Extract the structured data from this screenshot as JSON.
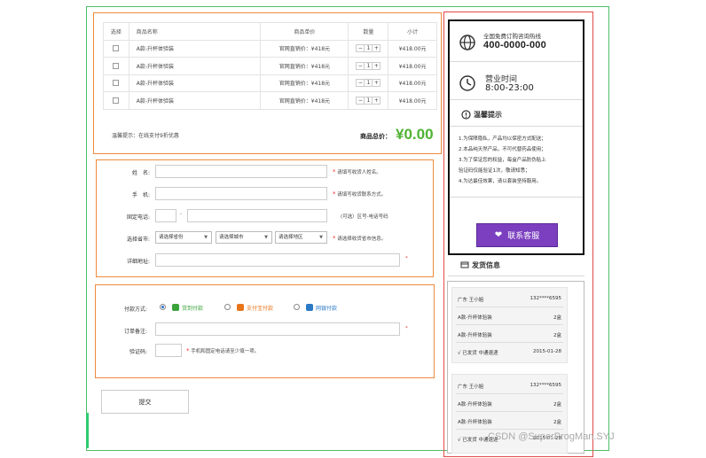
{
  "cart": {
    "headers": [
      "选择",
      "商品名称",
      "商品单价",
      "数量",
      "小计"
    ],
    "rows": [
      {
        "name": "A款-升杯体验装",
        "price": "官网直销价：¥418元",
        "qty": "1",
        "subtotal": "¥418.00元"
      },
      {
        "name": "A款-升杯体验装",
        "price": "官网直销价：¥418元",
        "qty": "1",
        "subtotal": "¥418.00元"
      },
      {
        "name": "A款-升杯体验装",
        "price": "官网直销价：¥418元",
        "qty": "1",
        "subtotal": "¥418.00元"
      },
      {
        "name": "A款-升杯体验装",
        "price": "官网直销价：¥418元",
        "qty": "1",
        "subtotal": "¥418.00元"
      }
    ],
    "stepper_minus": "−",
    "stepper_plus": "+",
    "tip": "温馨提示：在线支付9折优惠",
    "total_label": "商品总价：",
    "total_value": "¥0.00"
  },
  "address": {
    "name_label": "姓　名:",
    "name_hint": "请填写收货人姓名。",
    "phone_label": "手　机:",
    "phone_hint": "请填写收货联系方式。",
    "tel_label": "固定电话:",
    "tel_dash": "-",
    "tel_hint": "(可选）区号-电话号码",
    "city_label": "选择省市:",
    "province_select": "请选择省份",
    "city_select": "请选择城市",
    "district_select": "请选择地区",
    "city_hint": "请选择收货省市信息。",
    "detail_label": "详细地址:",
    "required_mark": "*"
  },
  "payment": {
    "method_label": "付款方式:",
    "options": [
      {
        "label": "货到付款",
        "color": "#3aa33a",
        "selected": true
      },
      {
        "label": "支付宝付款",
        "color": "#e8751a",
        "selected": false
      },
      {
        "label": "网银付款",
        "color": "#2a7ac7",
        "selected": false
      }
    ],
    "remark_label": "订单备注:",
    "captcha_label": "验证码:",
    "captcha_hint": "手机和固定电话请至少填一项。"
  },
  "submit_label": "提交",
  "sidebar": {
    "hotline_title": "全国免费订购咨询热线",
    "hotline_number": "400-0000-000",
    "hours_title": "营业时间",
    "hours_value": "8:00-23:00",
    "notice_title": "温馨提示",
    "notice_lines": [
      "1.为保障隐私，产品均以保密方式配送；",
      "2.本品纯天然产品，不可代替药品使用；",
      "3.为了保证您的权益，每盒产品防伪贴上",
      "验证码仅能验证1次，敬请知悉；",
      "4.为达最佳效果，请以套装坚持服用。"
    ],
    "service_button": "联系客服",
    "shipping_title": "发货信息",
    "shipping_cards": [
      {
        "person": "广东 王小姐",
        "phone": "132****6595",
        "items": [
          {
            "name": "A款-升杯体验装",
            "qty": "2盒"
          },
          {
            "name": "A款-升杯体验装",
            "qty": "2盒"
          }
        ],
        "status": "√ 已发货  中通速递",
        "date": "2015-01-28"
      },
      {
        "person": "广东 王小姐",
        "phone": "132****6595",
        "items": [
          {
            "name": "A款-升杯体验装",
            "qty": "2盒"
          },
          {
            "name": "A款-升杯体验装",
            "qty": "2盒"
          }
        ],
        "status": "√ 已发货  中通速递",
        "date": "2015-01-28"
      }
    ]
  },
  "watermark": "CSDN @SuperProgMan.SYJ",
  "colors": {
    "accent_green": "#4fb233",
    "orange_outline": "#f08a3c",
    "red_outline": "#e34a4a",
    "service_purple": "#7b3fbf"
  }
}
